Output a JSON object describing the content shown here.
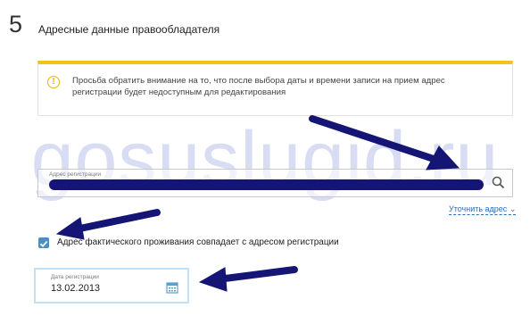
{
  "section": {
    "number": "5",
    "title": "Адресные данные правообладателя"
  },
  "warning": {
    "icon": "exclamation-circle",
    "text": "Просьба обратить внимание на то, что после выбора даты и времени записи на прием адрес регистрации будет недоступным для редактирования"
  },
  "watermark": "gosuslugid.ru",
  "address": {
    "label": "Адрес регистрации",
    "value": "",
    "clarify_link": "Уточнить адрес",
    "search_icon": "magnifier"
  },
  "checkbox": {
    "checked": true,
    "label": "Адрес фактического проживания совпадает с адресом регистрации"
  },
  "date": {
    "label": "Дата регистрации",
    "value": "13.02.2013",
    "icon": "calendar"
  },
  "colors": {
    "accent_yellow": "#f0c419",
    "link_blue": "#2a6fb5",
    "checkbox_blue": "#4a8fc4",
    "arrow_navy": "#151575",
    "focus_border": "#bfe2f2"
  }
}
